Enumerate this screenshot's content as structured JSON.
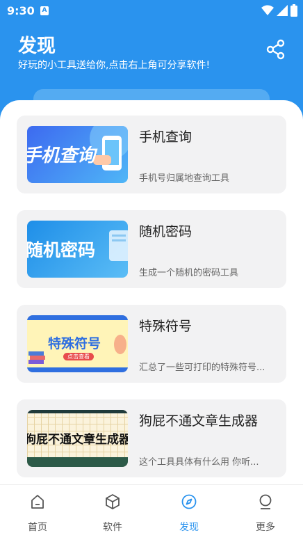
{
  "status": {
    "time": "9:30",
    "notif_letter": "A"
  },
  "header": {
    "title": "发现",
    "subtitle": "好玩的小工具送给你,点击右上角可分享软件!"
  },
  "tools": [
    {
      "title": "手机查询",
      "desc": "手机号归属地查询工具",
      "thumb_text": "手机查询"
    },
    {
      "title": "随机密码",
      "desc": "生成一个随机的密码工具",
      "thumb_text": "随机密码"
    },
    {
      "title": "特殊符号",
      "desc": "汇总了一些可打印的特殊符号...",
      "thumb_text": "特殊符号",
      "thumb_badge": "点击查看"
    },
    {
      "title": "狗屁不通文章生成器",
      "desc": "这个工具具体有什么用 你听...",
      "thumb_text": "狗屁不通文章生成器"
    }
  ],
  "nav": [
    {
      "label": "首页",
      "icon": "home-icon"
    },
    {
      "label": "软件",
      "icon": "cube-icon"
    },
    {
      "label": "发现",
      "icon": "compass-icon",
      "active": true
    },
    {
      "label": "更多",
      "icon": "person-icon"
    }
  ],
  "colors": {
    "accent": "#2a93ee",
    "card_bg": "#f2f2f3"
  }
}
